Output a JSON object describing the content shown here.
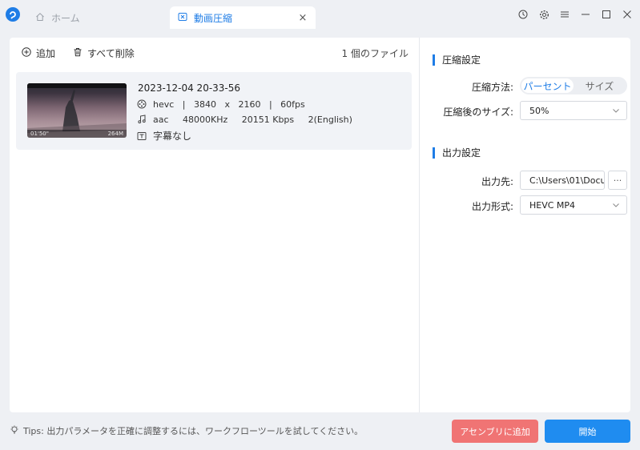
{
  "titlebar": {
    "home_tab_label": "ホーム",
    "active_tab_label": "動画圧縮",
    "close_glyph": "×"
  },
  "toolbar": {
    "add_label": "追加",
    "delete_all_label": "すべて削除",
    "file_count": "1 個のファイル"
  },
  "file": {
    "name": "2023-12-04 20-33-56",
    "duration": "01'50\"",
    "size": "264M",
    "video": "hevc   |   3840   x   2160   |   60fps",
    "audio": "aac     48000KHz     20151 Kbps     2(English)",
    "subtitle": "字幕なし"
  },
  "settings": {
    "compression_title": "圧縮設定",
    "method_label": "圧縮方法:",
    "method_options": [
      "パーセント",
      "サイズ"
    ],
    "size_label": "圧縮後のサイズ:",
    "size_value": "50%",
    "output_title": "出力設定",
    "dest_label": "出力先:",
    "dest_value": "C:\\Users\\01\\Docu",
    "more_glyph": "···",
    "format_label": "出力形式:",
    "format_value": "HEVC MP4"
  },
  "footer": {
    "tips": "Tips: 出力パラメータを正確に調整するには、ワークフローツールを試してください。",
    "add_to_assembly": "アセンブリに追加",
    "start": "開始"
  },
  "colors": {
    "accent": "#1f7de6",
    "start_button": "#1f8cf0",
    "assembly_button": "#f07474"
  }
}
